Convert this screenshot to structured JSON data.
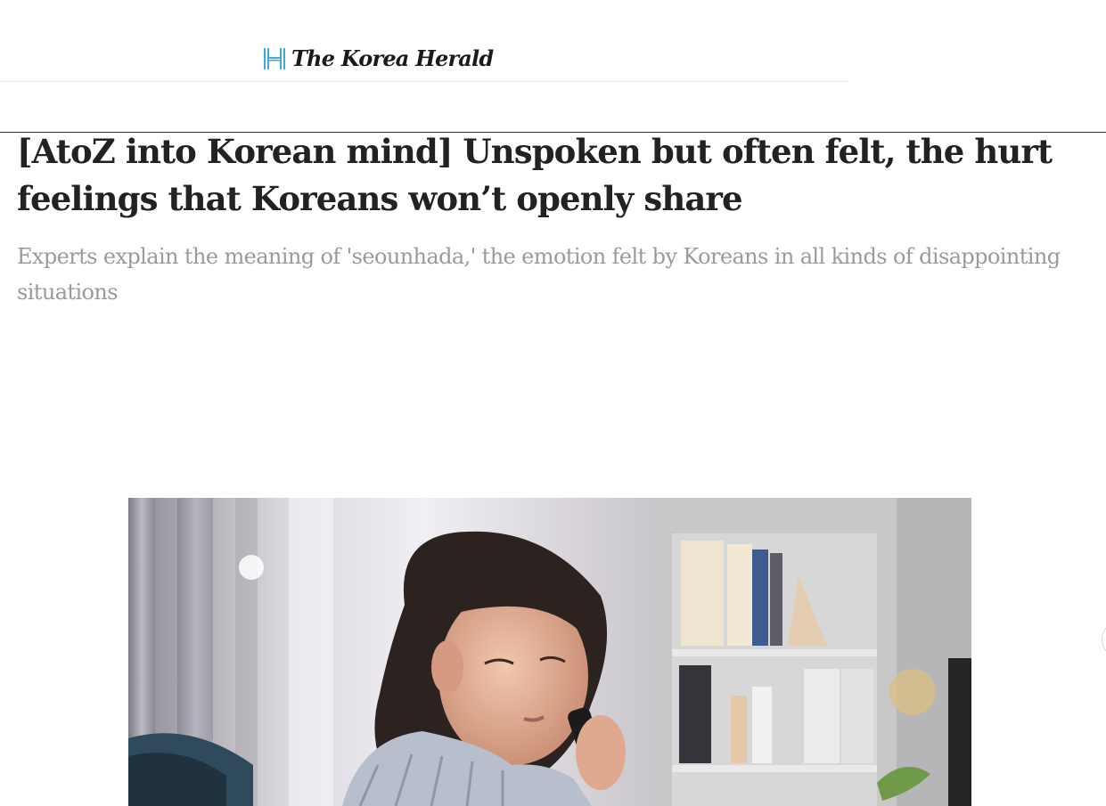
{
  "header": {
    "logo_text": "The Korea Herald"
  },
  "article": {
    "headline": "[AtoZ into Korean mind] Unspoken but often felt, the hurt feelings that Koreans won’t openly share",
    "subheadline": "Experts explain the meaning of 'seounhada,' the emotion felt by Koreans in all kinds of disappointing situations"
  },
  "colors": {
    "logo_mark": "#3fa9dc",
    "headline": "#222222",
    "subheadline": "#9a9a9a",
    "rule": "#333333"
  },
  "icons": {
    "logo_mark": "korea-herald-logo-icon",
    "side_nav": "carousel-next-icon"
  }
}
